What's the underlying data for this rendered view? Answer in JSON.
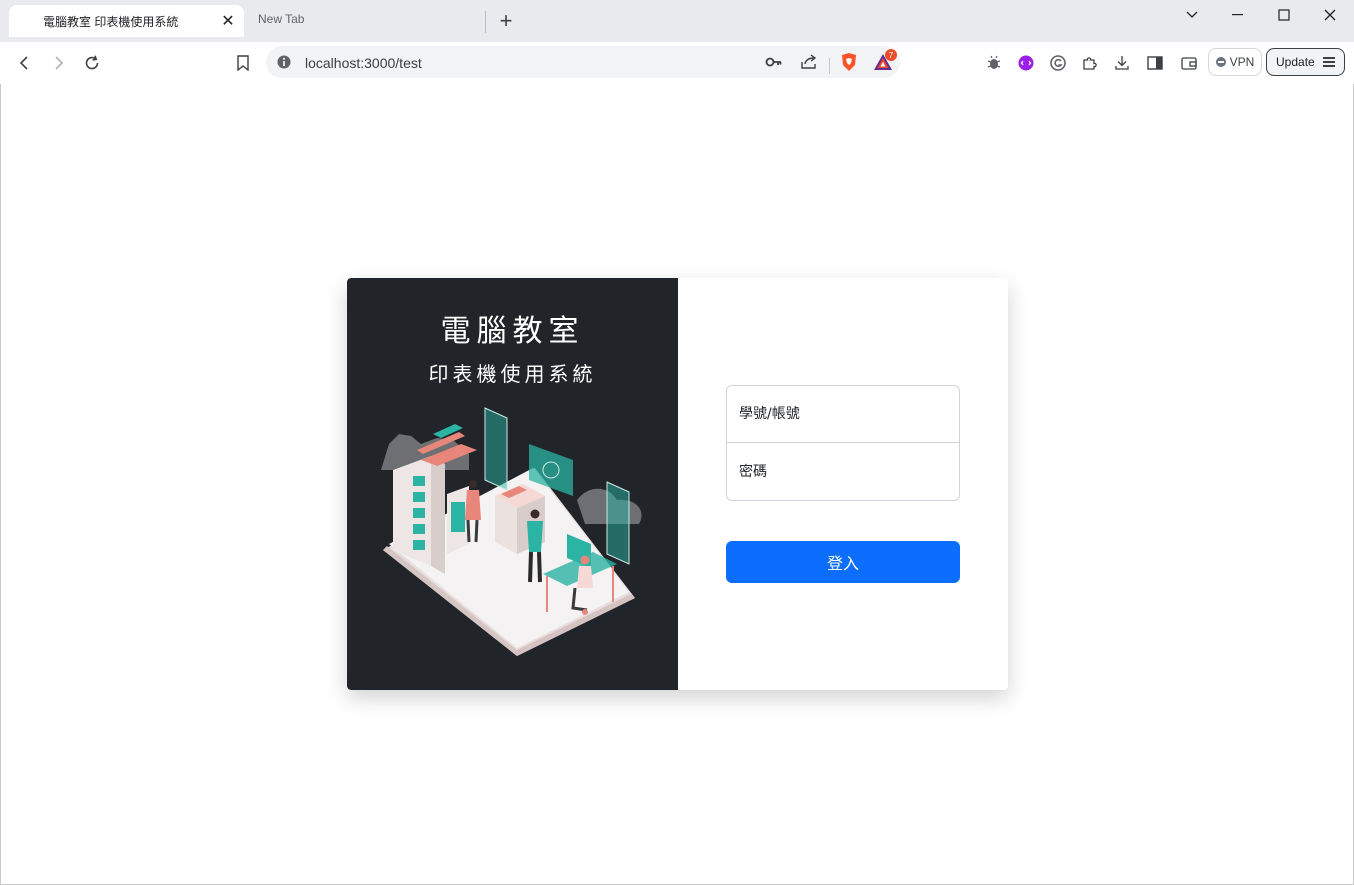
{
  "browser": {
    "tabs": [
      {
        "title": "電腦教室 印表機使用系統",
        "active": true
      },
      {
        "title": "New Tab",
        "active": false
      }
    ],
    "url": "localhost:3000/test",
    "vpn_label": "VPN",
    "update_label": "Update",
    "notification_count": "7"
  },
  "login": {
    "title": "電腦教室",
    "subtitle": "印表機使用系統",
    "username_placeholder": "學號/帳號",
    "password_placeholder": "密碼",
    "submit_label": "登入"
  },
  "colors": {
    "left_panel": "#212529",
    "primary_button": "#0d6efd",
    "illustration_accent": "#2bb3a3",
    "illustration_salmon": "#e8867c"
  }
}
